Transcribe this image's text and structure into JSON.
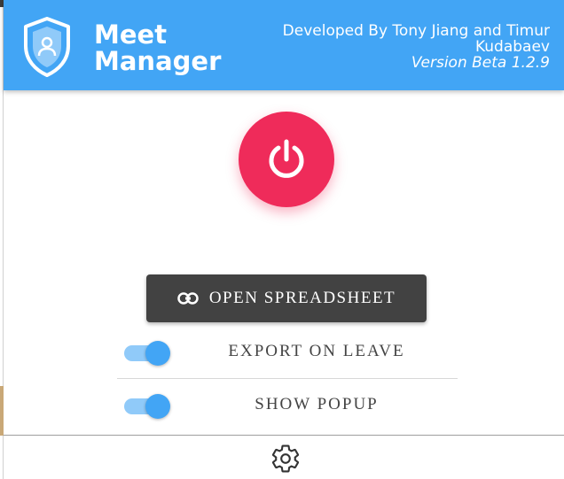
{
  "header": {
    "brand_line1": "Meet",
    "brand_line2": "Manager",
    "credits": "Developed By Tony Jiang and Timur Kudabaev",
    "version": "Version Beta 1.2.9"
  },
  "icons": {
    "logo": "shield-user-icon",
    "power": "power-icon",
    "link": "link-icon",
    "settings": "gear-icon"
  },
  "actions": {
    "open_spreadsheet": "OPEN SPREADSHEET"
  },
  "toggles": [
    {
      "label": "EXPORT ON LEAVE",
      "checked": true
    },
    {
      "label": "SHOW POPUP",
      "checked": true
    }
  ],
  "colors": {
    "header": "#42a5f5",
    "power": "#ef2b5a",
    "button": "#424242",
    "toggle_track": "#90caf9",
    "toggle_knob": "#42a5f5"
  }
}
